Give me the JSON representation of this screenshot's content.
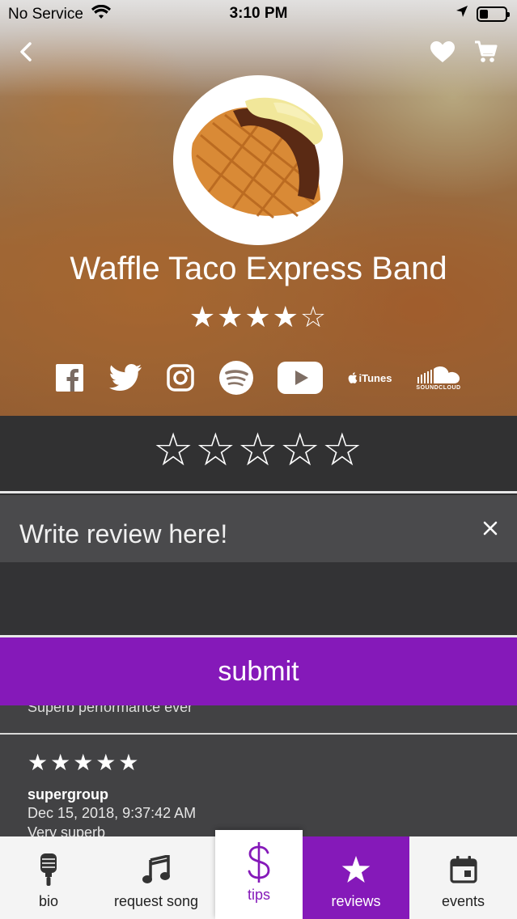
{
  "status_bar": {
    "carrier": "No Service",
    "time": "3:10 PM",
    "icons": [
      "wifi-icon",
      "location-arrow-icon",
      "battery-icon"
    ]
  },
  "header": {
    "back_icon": "chevron-left-icon",
    "favorite_icon": "heart-icon",
    "cart_icon": "shopping-cart-icon"
  },
  "band": {
    "name": "Waffle Taco Express Band",
    "rating_stars": "★★★★☆",
    "rating_value": 4,
    "rating_max": 5
  },
  "socials": [
    {
      "name": "facebook-icon"
    },
    {
      "name": "twitter-icon"
    },
    {
      "name": "instagram-icon"
    },
    {
      "name": "spotify-icon"
    },
    {
      "name": "youtube-icon"
    },
    {
      "name": "itunes-icon",
      "label": "iTunes"
    },
    {
      "name": "soundcloud-icon",
      "label": "SOUNDCLOUD"
    }
  ],
  "rate": {
    "stars": "☆☆☆☆☆",
    "selected": 0
  },
  "review_form": {
    "placeholder": "Write review here!",
    "clear_icon": "close-icon",
    "submit_label": "submit"
  },
  "reviews": {
    "partial_text": "Superb performance ever",
    "items": [
      {
        "stars": "★★★★★",
        "user": "supergroup",
        "date": "Dec 15, 2018, 9:37:42 AM",
        "text": "Very superb"
      }
    ]
  },
  "tabs": [
    {
      "label": "bio",
      "icon": "microphone-icon"
    },
    {
      "label": "request song",
      "icon": "music-note-icon"
    },
    {
      "label": "tips",
      "icon": "dollar-icon"
    },
    {
      "label": "reviews",
      "icon": "star-icon",
      "active": true
    },
    {
      "label": "events",
      "icon": "calendar-icon"
    }
  ],
  "colors": {
    "accent": "#8519b9",
    "panel_dark": "#313132",
    "review_bg": "#424244",
    "tabbar_bg": "#f4f4f4"
  }
}
